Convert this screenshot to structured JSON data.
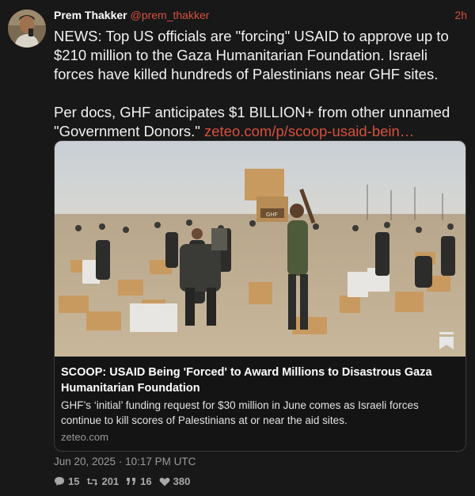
{
  "tweet": {
    "author_name": "Prem Thakker",
    "author_handle": "@prem_thakker",
    "time": "2h",
    "text_p1": "NEWS: Top US officials are \"forcing\" USAID to approve up to $210 million to the Gaza Humanitarian Foundation. Israeli forces have killed hundreds of Palestinians near GHF sites.",
    "text_p2": "Per docs, GHF anticipates $1 BILLION+ from other unnamed \"Government Donors.\"",
    "link_text": "zeteo.com/p/scoop-usaid-bein…",
    "date": "Jun 20, 2025 · 10:17 PM UTC"
  },
  "card": {
    "title": "SCOOP: USAID Being 'Forced' to Award Millions to Disastrous Gaza Humanitarian Foundation",
    "description": "GHF’s ‘initial’ funding request for $30 million in June comes as Israeli forces continue to kill scores of Palestinians at or near the aid sites.",
    "domain": "zeteo.com",
    "box_label": "GHF"
  },
  "stats": {
    "replies": "15",
    "retweets": "201",
    "quotes": "16",
    "likes": "380"
  },
  "icons": {
    "reply": "comment-icon",
    "retweet": "retweet-icon",
    "quote": "quote-icon",
    "like": "heart-icon",
    "bookmark": "bookmark-icon"
  },
  "colors": {
    "accent": "#d6503f",
    "background": "#181818",
    "muted": "#9a9a9a"
  }
}
